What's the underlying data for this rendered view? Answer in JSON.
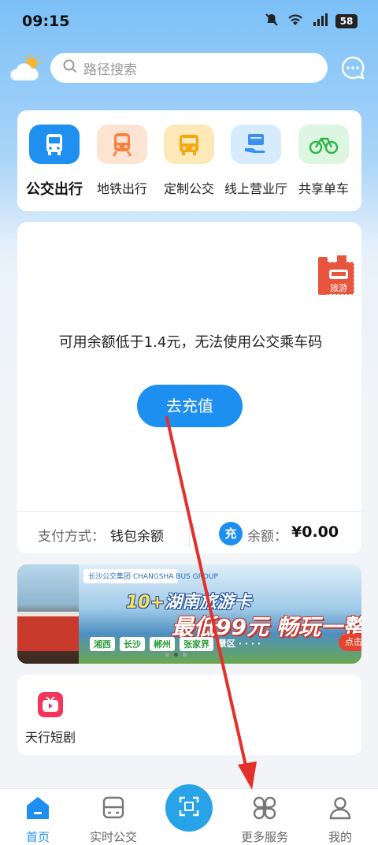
{
  "status_bar": {
    "time": "09:15",
    "battery": "58"
  },
  "header": {
    "search_placeholder": "路径搜索"
  },
  "entries": [
    {
      "label": "公交出行",
      "active": true
    },
    {
      "label": "地铁出行"
    },
    {
      "label": "定制公交"
    },
    {
      "label": "线上营业厅"
    },
    {
      "label": "共享单车"
    }
  ],
  "main": {
    "balance_message": "可用余额低于1.4元，无法使用公交乘车码",
    "recharge_label": "去充值",
    "stamp_label": "旅游",
    "pay_label": "支付方式：",
    "pay_value": "钱包余额",
    "charge_icon_label": "充",
    "balance_label": "余额：",
    "balance_value": "¥0.00"
  },
  "banner": {
    "logo_text": "长沙公交集团 CHANGSHA BUS GROUP",
    "title_prefix": "10+",
    "title_main": "湖南旅游卡",
    "subtitle": "最低99元  畅玩一整",
    "tags": [
      "湘西",
      "长沙",
      "郴州",
      "张家界"
    ],
    "tags_suffix": "景区 · · · ·",
    "button_label": "点击"
  },
  "apps": [
    {
      "label": "天行短剧"
    }
  ],
  "nav": [
    {
      "label": "首页",
      "active": true
    },
    {
      "label": "实时公交"
    },
    {
      "label": "更多服务"
    },
    {
      "label": "我的"
    }
  ],
  "colors": {
    "accent": "#1d8ff0",
    "annotation_arrow": "#e3302a"
  }
}
